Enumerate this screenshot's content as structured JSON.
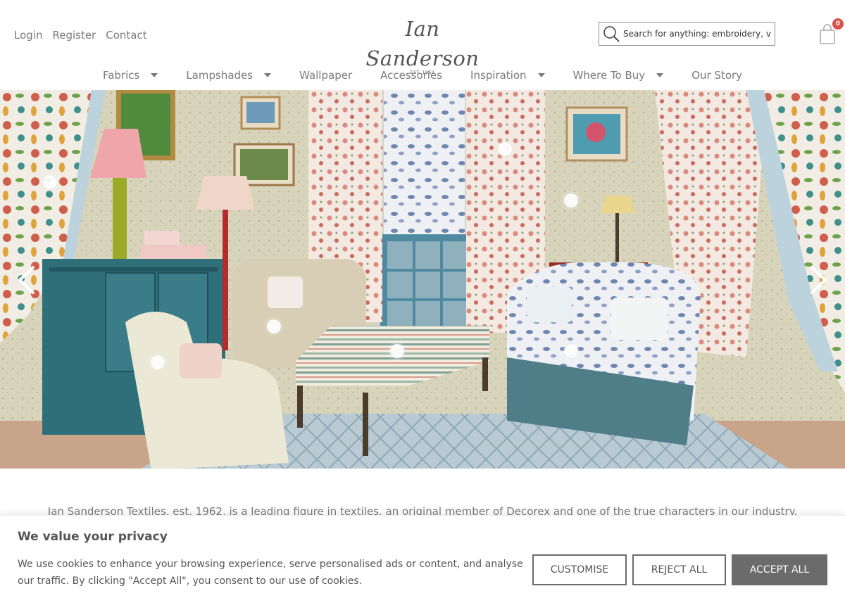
{
  "header": {
    "account_links": [
      "Login",
      "Register",
      "Contact"
    ],
    "logo": {
      "name": "Ian Sanderson",
      "tagline": "EST. 1962"
    },
    "search": {
      "placeholder": "Search for anything: embroidery, v"
    },
    "cart": {
      "count": "0",
      "icon": "shopping-bag-icon"
    }
  },
  "nav": {
    "items": [
      {
        "label": "Fabrics",
        "has_dropdown": true
      },
      {
        "label": "Lampshades",
        "has_dropdown": true
      },
      {
        "label": "Wallpaper",
        "has_dropdown": false
      },
      {
        "label": "Accessories",
        "has_dropdown": false
      },
      {
        "label": "Inspiration",
        "has_dropdown": true
      },
      {
        "label": "Where To Buy",
        "has_dropdown": true
      },
      {
        "label": "Our Story",
        "has_dropdown": false
      }
    ]
  },
  "hero": {
    "prev_icon": "chevron-left-icon",
    "next_icon": "chevron-right-icon",
    "hotspot_count": 8
  },
  "intro": {
    "text": "Ian Sanderson Textiles, est. 1962, is a leading figure in textiles, an original member of Decorex and one of the true characters in our industry."
  },
  "cookie": {
    "title": "We value your privacy",
    "text": "We use cookies to enhance your browsing experience, serve personalised ads or content, and analyse our traffic. By clicking \"Accept All\", you consent to our use of cookies.",
    "customise_label": "CUSTOMISE",
    "reject_label": "REJECT ALL",
    "accept_label": "ACCEPT ALL"
  },
  "colors": {
    "text": "#7a7a7a",
    "button_dark": "#6b6b6b",
    "badge": "#d9534f"
  }
}
